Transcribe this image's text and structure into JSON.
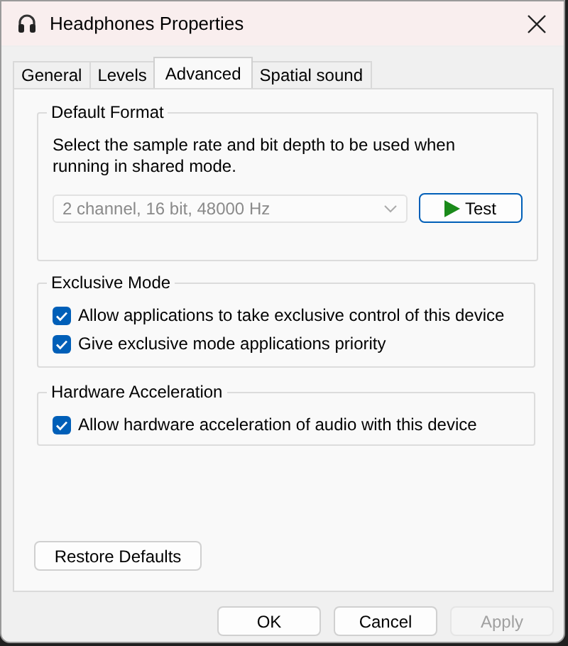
{
  "window": {
    "title": "Headphones Properties"
  },
  "tabs": [
    {
      "label": "General",
      "selected": false
    },
    {
      "label": "Levels",
      "selected": false
    },
    {
      "label": "Advanced",
      "selected": true
    },
    {
      "label": "Spatial sound",
      "selected": false
    }
  ],
  "groups": [
    {
      "kind": "format",
      "title": "Default Format",
      "description": "Select the sample rate and bit depth to be used when running in shared mode.",
      "format_select": {
        "value": "2 channel, 16 bit, 48000 Hz",
        "disabled": true
      },
      "test_button": "Test"
    },
    {
      "kind": "checks",
      "title": "Exclusive Mode",
      "options": [
        {
          "label": "Allow applications to take exclusive control of this device",
          "checked": true
        },
        {
          "label": "Give exclusive mode applications priority",
          "checked": true
        }
      ]
    },
    {
      "kind": "checks",
      "title": "Hardware Acceleration",
      "options": [
        {
          "label": "Allow hardware acceleration of audio with this device",
          "checked": true
        }
      ]
    }
  ],
  "restore_button": "Restore Defaults",
  "buttons": [
    {
      "label": "OK",
      "disabled": false
    },
    {
      "label": "Cancel",
      "disabled": false
    },
    {
      "label": "Apply",
      "disabled": true
    }
  ]
}
